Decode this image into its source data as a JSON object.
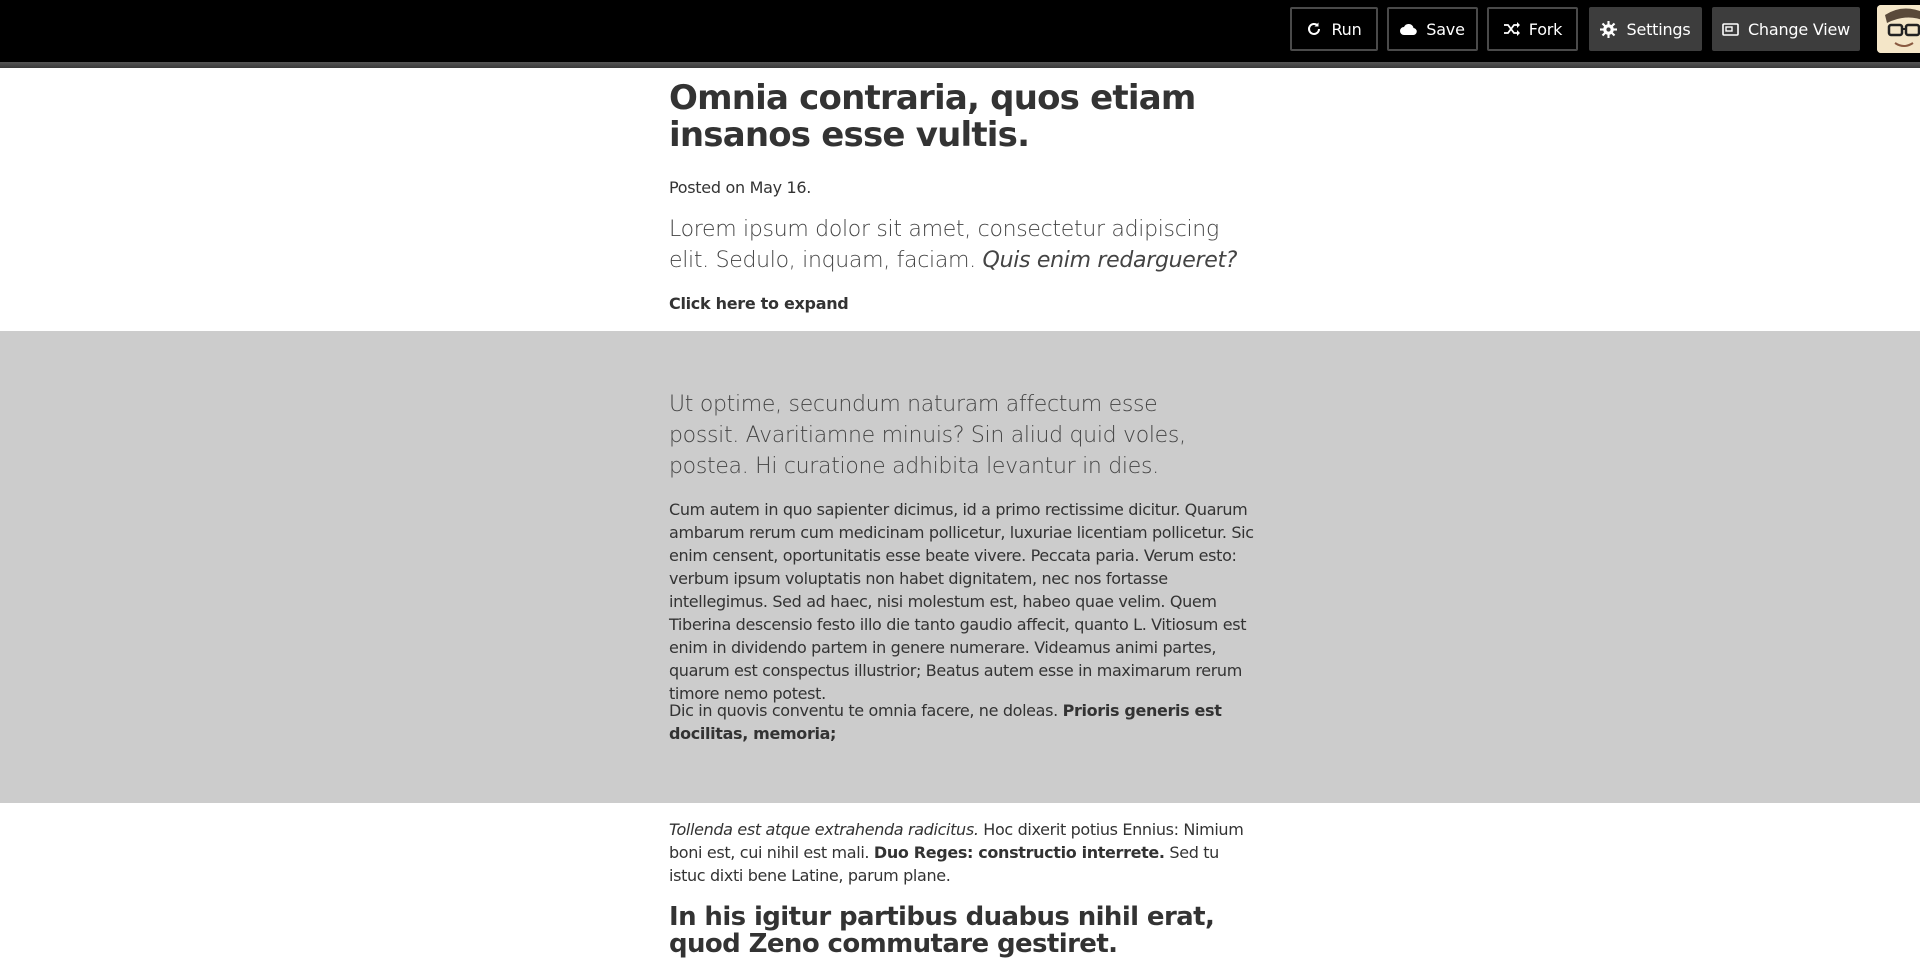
{
  "toolbar": {
    "run_label": "Run",
    "save_label": "Save",
    "fork_label": "Fork",
    "settings_label": "Settings",
    "change_view_label": "Change View",
    "run_icon": "refresh-icon",
    "save_icon": "cloud-icon",
    "fork_icon": "shuffle-icon",
    "settings_icon": "gear-icon",
    "change_view_icon": "window-icon"
  },
  "article": {
    "title": "Omnia contraria, quos etiam insanos esse vultis.",
    "posted": "Posted on May 16.",
    "lede_plain": "Lorem ipsum dolor sit amet, consectetur adipiscing elit. Sedulo, inquam, faciam. ",
    "lede_italic": "Quis enim redargueret?",
    "expand_link": "Click here to expand"
  },
  "expanded": {
    "lede": "Ut optime, secundum naturam affectum esse possit. Avaritiamne minuis? Sin aliud quid voles, postea. Hi curatione adhibita levantur in dies.",
    "paragraph1": "Cum autem in quo sapienter dicimus, id a primo rectissime dicitur. Quarum ambarum rerum cum medicinam pollicetur, luxuriae licentiam pollicetur. Sic enim censent, oportunitatis esse beate vivere. Peccata paria. Verum esto: verbum ipsum voluptatis non habet dignitatem, nec nos fortasse intellegimus. Sed ad haec, nisi molestum est, habeo quae velim. Quem Tiberina descensio festo illo die tanto gaudio affecit, quanto L. Vitiosum est enim in dividendo partem in genere numerare. Videamus animi partes, quarum est conspectus illustrior; Beatus autem esse in maximarum rerum timore nemo potest.",
    "paragraph2_plain": "Dic in quovis conventu te omnia facere, ne doleas. ",
    "paragraph2_bold": "Prioris generis est docilitas, memoria;"
  },
  "after": {
    "p_italic": "Tollenda est atque extrahenda radicitus.",
    "p_plain1": " Hoc dixerit potius Ennius: Nimium boni est, cui nihil est mali. ",
    "p_bold": "Duo Reges: constructio interrete.",
    "p_plain2": " Sed tu istuc dixti bene Latine, parum plane.",
    "subheading": "In his igitur partibus duabus nihil erat, quod Zeno commutare gestiret."
  }
}
